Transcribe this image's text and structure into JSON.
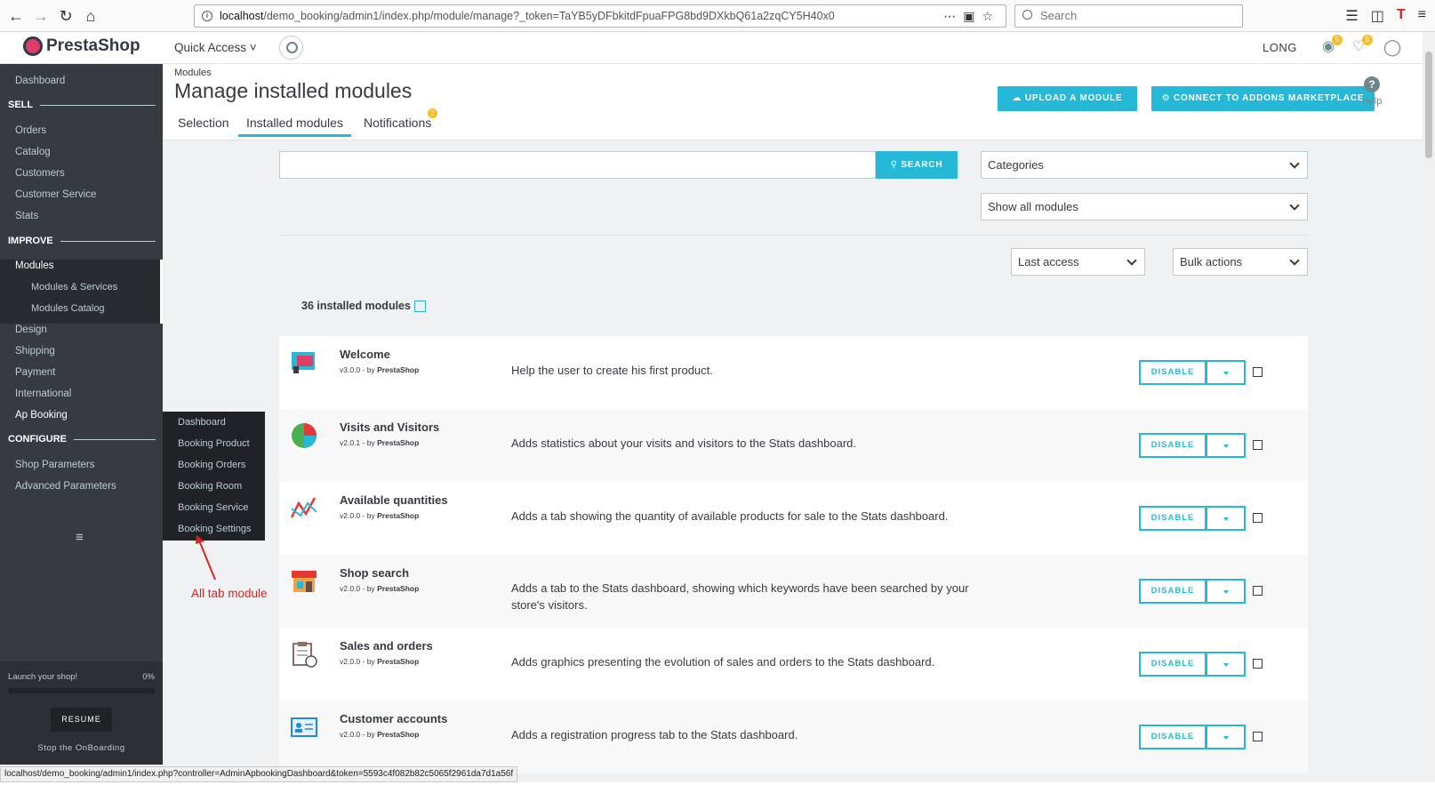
{
  "browser": {
    "url_host": "localhost",
    "url_path": "/demo_booking/admin1/index.php/module/manage?_token=TaYB5yDFbkitdFpuaFPG8bd9DXkbQ61a2zqCY5H40x0",
    "search_placeholder": "Search",
    "status_url": "localhost/demo_booking/admin1/index.php?controller=AdminApbookingDashboard&token=5593c4f082b82c5065f2961da7d1a56f"
  },
  "header": {
    "logo": "PrestaShop",
    "quick_access": "Quick Access",
    "employee": "LONG",
    "notif_orders": "5",
    "notif_messages": "5"
  },
  "sidebar": {
    "dashboard": "Dashboard",
    "sell": "SELL",
    "orders": "Orders",
    "catalog": "Catalog",
    "customers": "Customers",
    "customer_service": "Customer Service",
    "stats": "Stats",
    "improve": "IMPROVE",
    "modules": "Modules",
    "modules_services": "Modules & Services",
    "modules_catalog": "Modules Catalog",
    "design": "Design",
    "shipping": "Shipping",
    "payment": "Payment",
    "international": "International",
    "ap_booking": "Ap Booking",
    "configure": "CONFIGURE",
    "shop_parameters": "Shop Parameters",
    "advanced_parameters": "Advanced Parameters",
    "onboarding": {
      "label": "Launch your shop!",
      "percent": "0%",
      "progress": 0,
      "resume": "RESUME",
      "stop": "Stop the OnBoarding"
    }
  },
  "flyout": {
    "items": [
      "Dashboard",
      "Booking Product",
      "Booking Orders",
      "Booking Room",
      "Booking Service",
      "Booking Settings"
    ]
  },
  "annotation": "All tab module",
  "page": {
    "breadcrumb": "Modules",
    "title": "Manage installed modules",
    "tabs": [
      "Selection",
      "Installed modules",
      "Notifications"
    ],
    "notifications_badge": "2",
    "upload_button": "UPLOAD A MODULE",
    "connect_button": "CONNECT TO ADDONS MARKETPLACE",
    "help": "Help"
  },
  "filters": {
    "search_button": "SEARCH",
    "categories": "Categories",
    "show_all": "Show all modules",
    "sort": "Last access",
    "bulk": "Bulk actions"
  },
  "count_label": "36 installed modules",
  "modules": [
    {
      "name": "Welcome",
      "version": "v3.0.0 - by ",
      "author": "PrestaShop",
      "desc": "Help the user to create his first product.",
      "action": "DISABLE"
    },
    {
      "name": "Visits and Visitors",
      "version": "v2.0.1 - by ",
      "author": "PrestaShop",
      "desc": "Adds statistics about your visits and visitors to the Stats dashboard.",
      "action": "DISABLE"
    },
    {
      "name": "Available quantities",
      "version": "v2.0.0 - by ",
      "author": "PrestaShop",
      "desc": "Adds a tab showing the quantity of available products for sale to the Stats dashboard.",
      "action": "DISABLE"
    },
    {
      "name": "Shop search",
      "version": "v2.0.0 - by ",
      "author": "PrestaShop",
      "desc": "Adds a tab to the Stats dashboard, showing which keywords have been searched by your store's visitors.",
      "action": "DISABLE"
    },
    {
      "name": "Sales and orders",
      "version": "v2.0.0 - by ",
      "author": "PrestaShop",
      "desc": "Adds graphics presenting the evolution of sales and orders to the Stats dashboard.",
      "action": "DISABLE"
    },
    {
      "name": "Customer accounts",
      "version": "v2.0.0 - by ",
      "author": "PrestaShop",
      "desc": "Adds a registration progress tab to the Stats dashboard.",
      "action": "DISABLE"
    }
  ]
}
